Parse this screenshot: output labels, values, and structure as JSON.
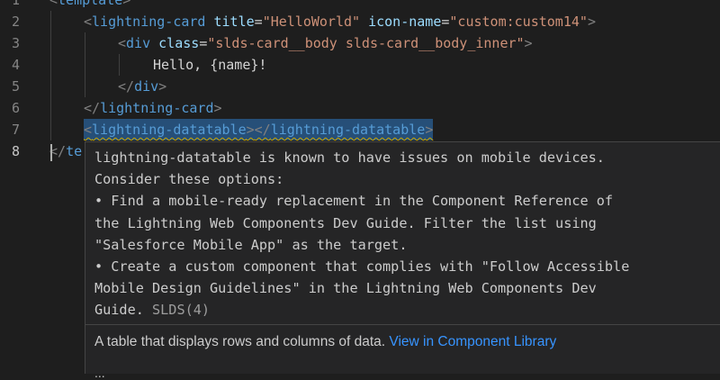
{
  "editor": {
    "line_numbers": [
      "1",
      "2",
      "3",
      "4",
      "5",
      "6",
      "7",
      "8"
    ],
    "line1": {
      "open": "<",
      "tag": "template",
      "close": ">"
    },
    "line2": {
      "open": "<",
      "tag": "lightning-card",
      "attr1": "title",
      "eq1": "=",
      "val1": "\"HelloWorld\"",
      "attr2": "icon-name",
      "eq2": "=",
      "val2": "\"custom:custom14\"",
      "close": ">"
    },
    "line3": {
      "open": "<",
      "tag": "div",
      "attr1": "class",
      "eq1": "=",
      "val1": "\"slds-card__body slds-card__body_inner\"",
      "close": ">"
    },
    "line4": {
      "text": "Hello, {name}!"
    },
    "line5": {
      "open": "</",
      "tag": "div",
      "close": ">"
    },
    "line6": {
      "open": "</",
      "tag": "lightning-card",
      "close": ">"
    },
    "line7": {
      "open1": "<",
      "tag1": "lightning-datatable",
      "close1": ">",
      "open2": "</",
      "tag2": "lightning-datatable",
      "close2": ">"
    },
    "line8": {
      "open": "</",
      "tag": "te"
    }
  },
  "hover": {
    "message_lines": [
      "lightning-datatable is known to have issues on mobile devices.",
      "Consider these options:",
      "• Find a mobile-ready replacement in the Component Reference of",
      "the Lightning Web Components Dev Guide. Filter the list using",
      "\"Salesforce Mobile App\" as the target.",
      "• Create a custom component that complies with \"Follow Accessible",
      "Mobile Design Guidelines\" in the Lightning Web Components Dev",
      "Guide. "
    ],
    "source": "SLDS(4)",
    "description": "A table that displays rows and columns of data. ",
    "link": "View in Component Library",
    "more": "..."
  }
}
